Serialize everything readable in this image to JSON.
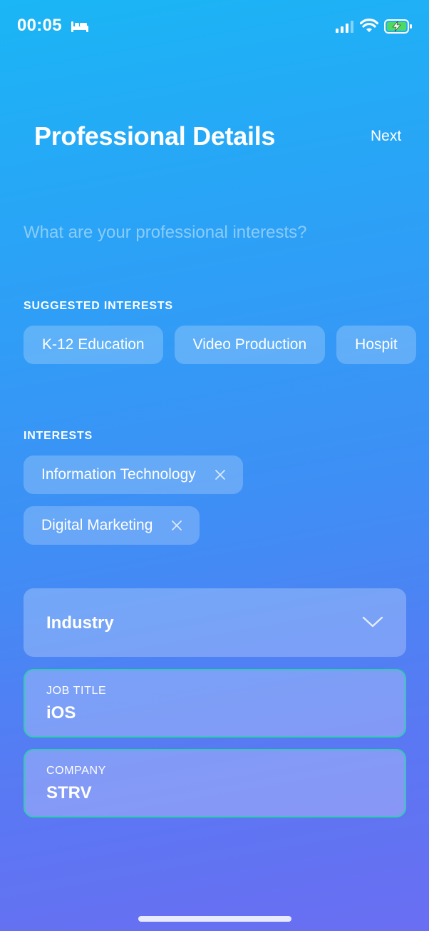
{
  "status_bar": {
    "time": "00:05",
    "icons": [
      "bed-icon",
      "cellular-signal-icon",
      "wifi-icon",
      "battery-charging-icon"
    ]
  },
  "header": {
    "title": "Professional Details",
    "next_label": "Next"
  },
  "search": {
    "placeholder": "What are your professional interests?"
  },
  "suggested": {
    "label": "SUGGESTED INTERESTS",
    "items": [
      "K-12 Education",
      "Video Production",
      "Hospit"
    ]
  },
  "interests": {
    "label": "INTERESTS",
    "items": [
      "Information Technology",
      "Digital Marketing"
    ]
  },
  "industry": {
    "label": "Industry",
    "icon": "chevron-down-icon"
  },
  "job_title": {
    "label": "JOB TITLE",
    "value": "iOS"
  },
  "company": {
    "label": "COMPANY",
    "value": "STRV"
  },
  "colors": {
    "gradient_top": "#1ab6f5",
    "gradient_bottom": "#6a6ef2",
    "field_border": "#36c9b6",
    "battery_fill": "#4cd964"
  }
}
